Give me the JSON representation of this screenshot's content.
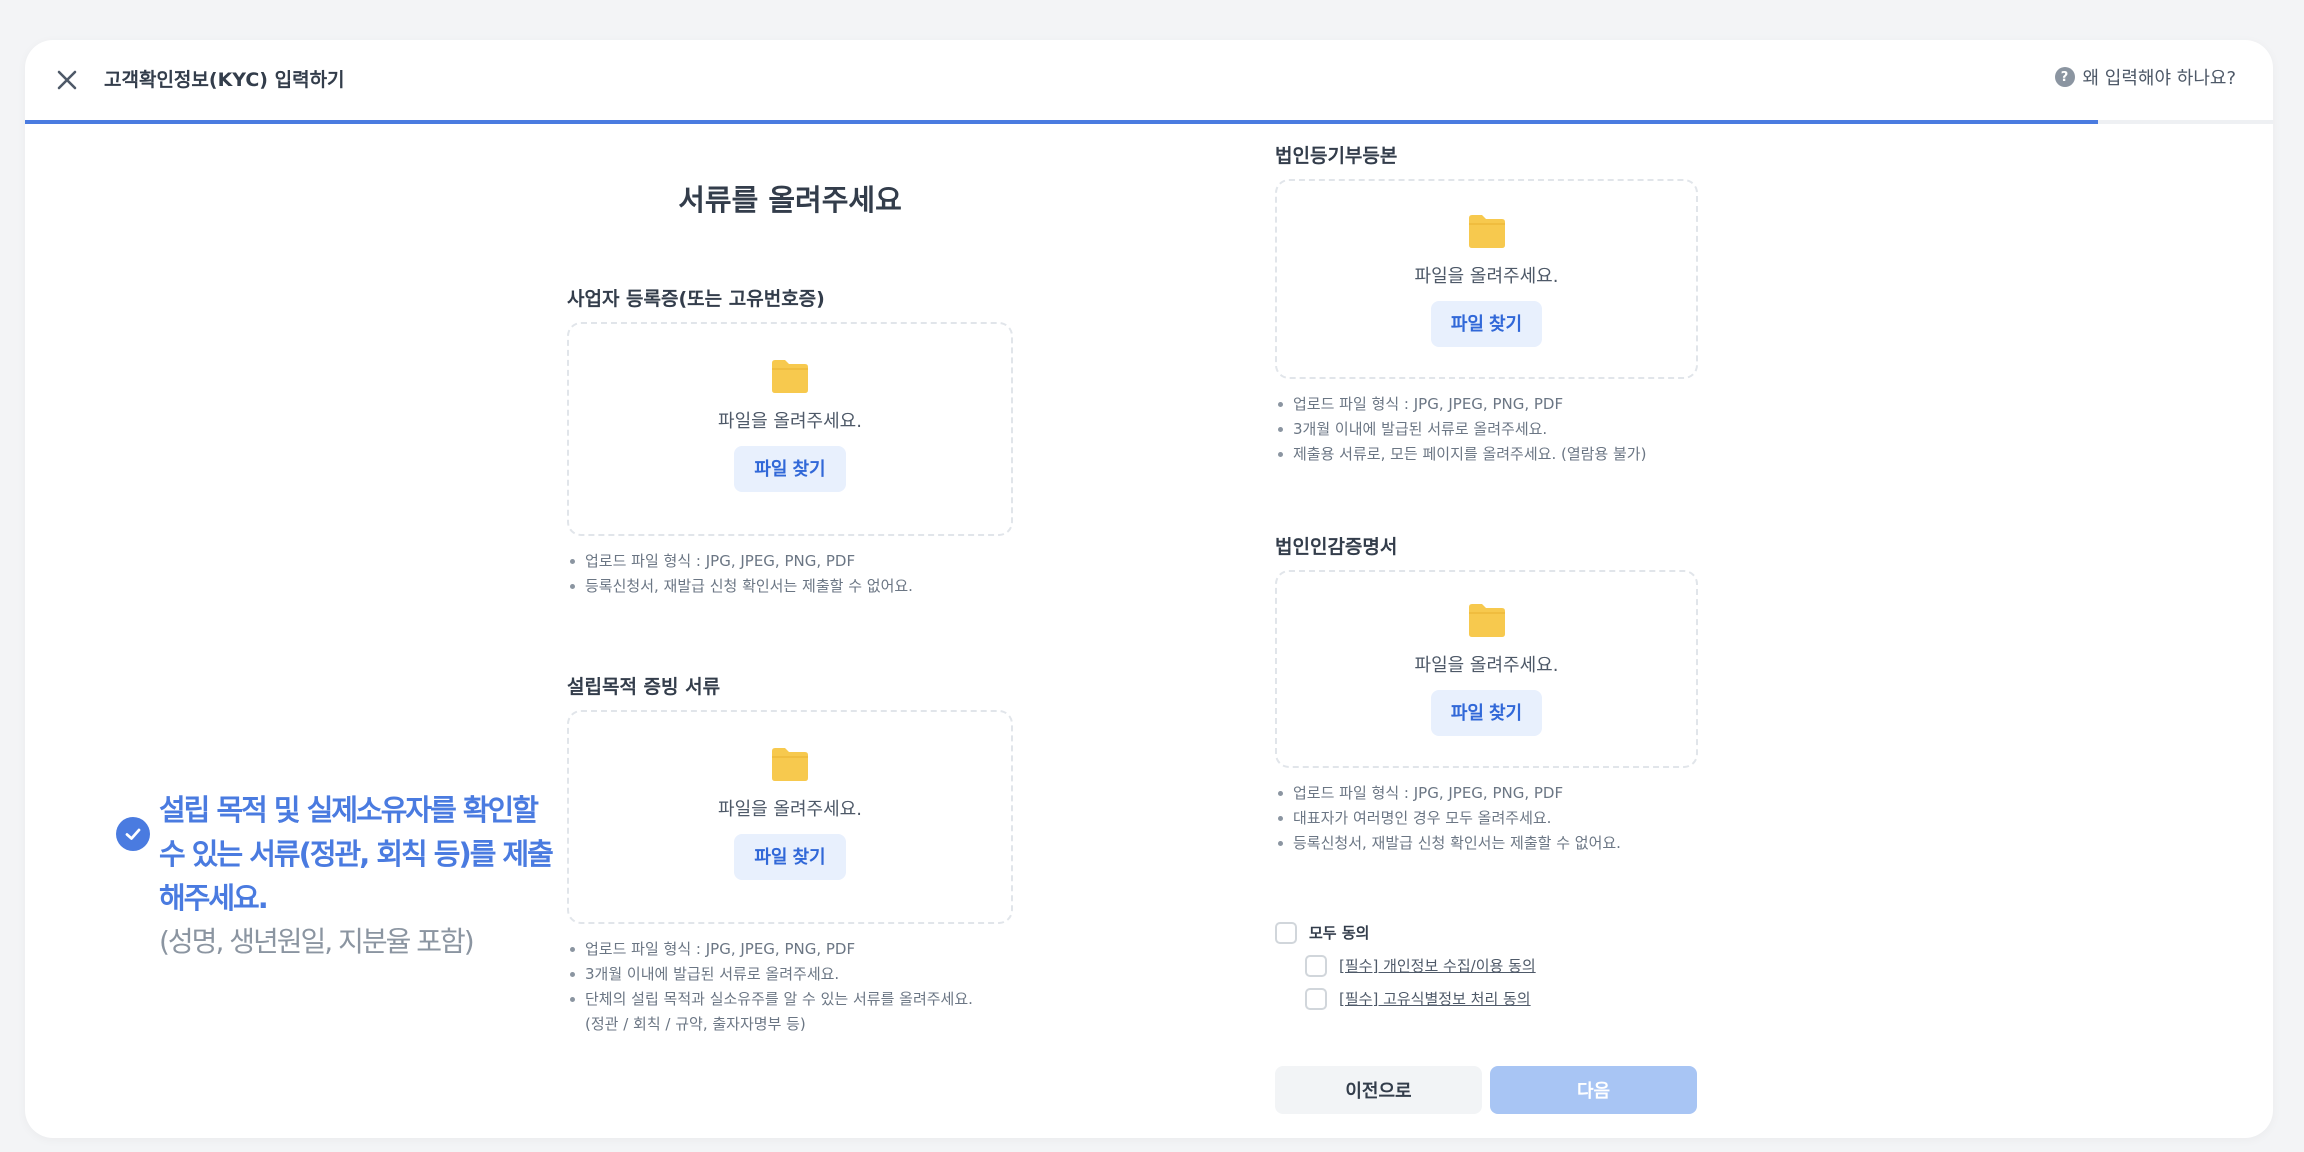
{
  "header": {
    "title": "고객확인정보(KYC) 입력하기",
    "help_label": "왜 입력해야 하나요?",
    "progress_fraction": 0.922
  },
  "side_message": {
    "title": "설립 목적 및 실제소유자를 확인할 수 있는 서류(정관, 회칙 등)를 제출해주세요.",
    "subtitle": "(성명, 생년원일, 지분율 포함)"
  },
  "main": {
    "page_title": "서류를 올려주세요",
    "sections": [
      {
        "label": "사업자 등록증(또는 고유번호증)",
        "drop_text": "파일을 올려주세요.",
        "button_label": "파일 찾기",
        "notes": [
          "업로드 파일 형식 : JPG, JPEG, PNG, PDF",
          "등록신청서, 재발급 신청 확인서는 제출할 수 없어요."
        ]
      },
      {
        "label": "설립목적 증빙 서류",
        "drop_text": "파일을 올려주세요.",
        "button_label": "파일 찾기",
        "notes": [
          "업로드 파일 형식 : JPG, JPEG, PNG, PDF",
          "3개월 이내에 발급된 서류로 올려주세요.",
          "단체의 설립 목적과 실소유주를 알 수 있는 서류를 올려주세요."
        ],
        "note_continuation": "(정관 / 회칙 / 규약, 출자자명부 등)"
      },
      {
        "label": "법인등기부등본",
        "drop_text": "파일을 올려주세요.",
        "button_label": "파일 찾기",
        "notes": [
          "업로드 파일 형식 : JPG, JPEG, PNG, PDF",
          "3개월 이내에 발급된 서류로 올려주세요.",
          "제출용 서류로, 모든 페이지를 올려주세요. (열람용 불가)"
        ]
      },
      {
        "label": "법인인감증명서",
        "drop_text": "파일을 올려주세요.",
        "button_label": "파일 찾기",
        "notes": [
          "업로드 파일 형식 : JPG, JPEG, PNG, PDF",
          "대표자가 여러명인 경우 모두 올려주세요.",
          "등록신청서, 재발급 신청 확인서는 제출할 수 없어요."
        ]
      }
    ]
  },
  "agreement": {
    "all_label": "모두 동의",
    "items": [
      "[필수] 개인정보 수집/이용 동의",
      "[필수] 고유식별정보 처리 동의"
    ]
  },
  "footer": {
    "prev_label": "이전으로",
    "next_label": "다음"
  },
  "colors": {
    "accent": "#4a7be0",
    "folder": "#f7c94e",
    "button_bg": "#e8f0fd",
    "next_disabled": "#a8c5f4"
  },
  "icons": [
    "close-icon",
    "help-icon",
    "check-circle-icon",
    "folder-icon"
  ]
}
